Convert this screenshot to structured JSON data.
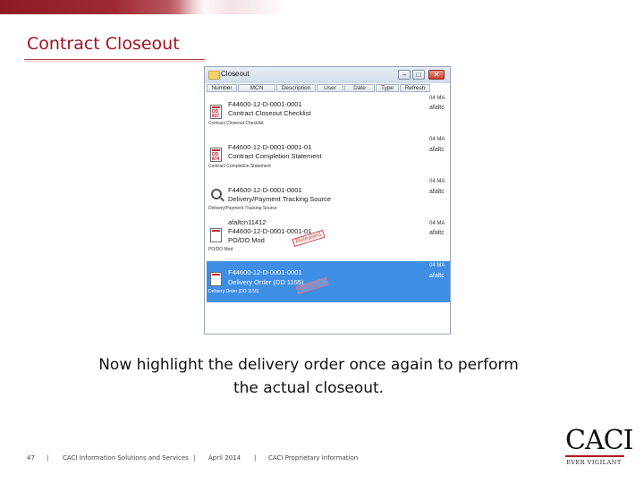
{
  "slide": {
    "title": "Contract Closeout",
    "caption_line1": "Now highlight the delivery order once again to perform",
    "caption_line2": "the actual closeout."
  },
  "window": {
    "title": "Closeout",
    "buttons": {
      "minimize": "–",
      "maximize": "□",
      "close": "✕"
    },
    "columns": [
      "Number",
      "MCN",
      "Description",
      "User",
      "Date",
      "Type",
      "Refresh"
    ],
    "rows": [
      {
        "icon": "document-icon",
        "icon_tag": "DD 837",
        "line1": "F44600-12-D-0001-0001",
        "line2": "Contract Closeout Checklist",
        "line3": "Contract Closeout Checklist",
        "side_header": "04 MA",
        "side_user": "afaltc",
        "stamp": "",
        "selected": false
      },
      {
        "icon": "document-icon",
        "icon_tag": "DD 874",
        "line1": "F44600-12-D-0001-0001-01",
        "line2": "Contract Completion Statement",
        "line3": "Contract Completion Statement",
        "side_header": "04 MA",
        "side_user": "afaltc",
        "stamp": "",
        "selected": false
      },
      {
        "icon": "magnifier-icon",
        "icon_tag": "",
        "line1": "F44600-12-D-0001-0001",
        "line2": "Delivery/Payment Tracking Source",
        "line3": "Delivery/Payment Tracking Source",
        "side_header": "04 MA",
        "side_user": "afaltc",
        "stamp": "",
        "selected": false
      },
      {
        "icon": "document-icon",
        "icon_tag": "",
        "line0": "afaltcn11412",
        "line1": "F44600-12-D-0001-0001-01",
        "line2": "PO/DO Mod",
        "line3": "PO/DO Mod",
        "side_header": "04 MA",
        "side_user": "afaltc",
        "stamp": "Released",
        "selected": false
      },
      {
        "icon": "document-icon",
        "icon_tag": "",
        "line1": "F44600-12-D-0001-0001",
        "line2": "Delivery Order (DD 1155)",
        "line3": "Delivery Order (DD 1155)",
        "side_header": "04 MA",
        "side_user": "afaltc",
        "stamp": "Released",
        "selected": true
      }
    ]
  },
  "footer": {
    "page_number": "47",
    "separator": "|",
    "company": "CACI Information Solutions and Services",
    "date": "April 2014",
    "classification": "CACI Proprietary Information"
  },
  "logo": {
    "name": "CACI",
    "tagline": "EVER VIGILANT"
  },
  "colors": {
    "brand_red": "#a3121c",
    "selection_blue": "#3f8ee6"
  }
}
